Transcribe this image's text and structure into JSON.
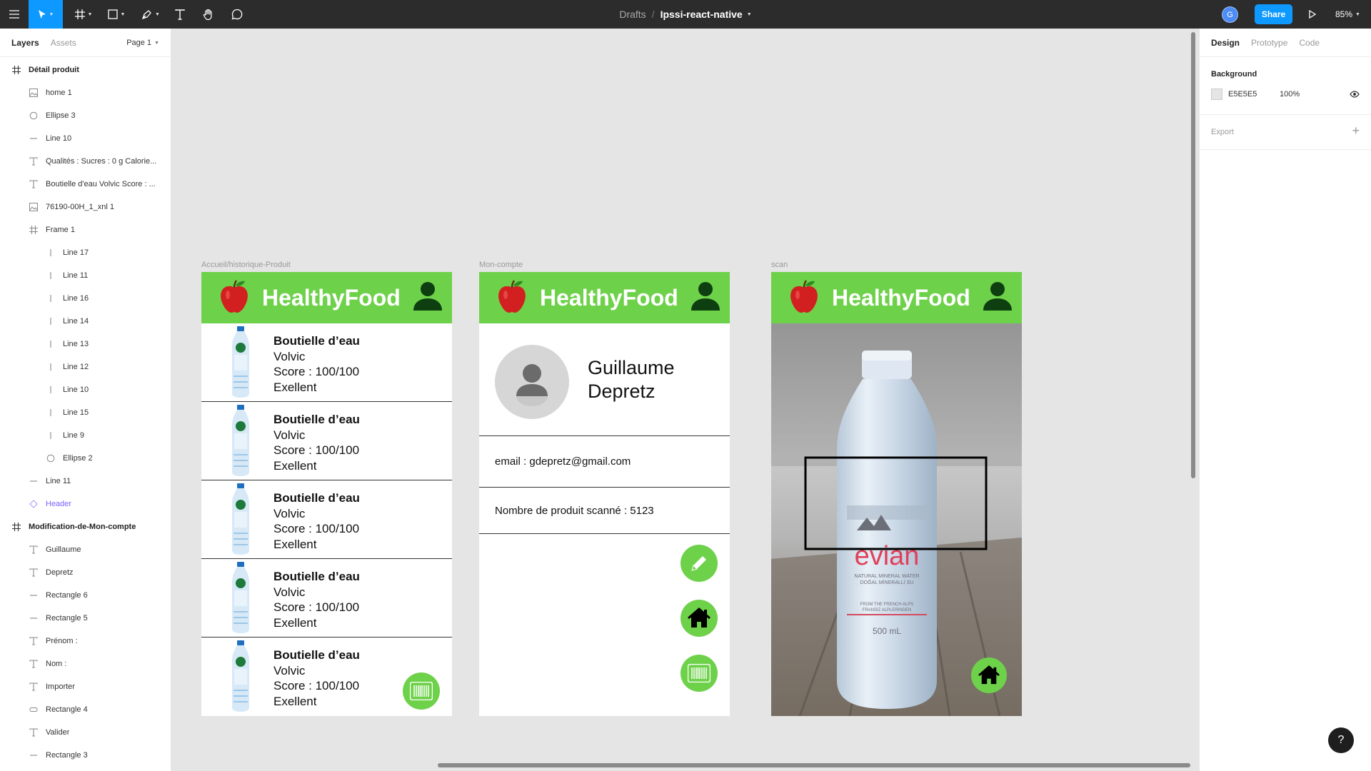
{
  "topbar": {
    "breadcrumb_drafts": "Drafts",
    "breadcrumb_sep": "/",
    "file_name": "Ipssi-react-native",
    "avatar_initial": "G",
    "share_label": "Share",
    "zoom": "85%",
    "tools": [
      "menu-icon",
      "move-icon",
      "frame-icon",
      "shape-icon",
      "pen-icon",
      "text-icon",
      "hand-icon",
      "comment-icon"
    ],
    "accent_color": "#0d99ff"
  },
  "left_panel": {
    "tab_layers": "Layers",
    "tab_assets": "Assets",
    "page_selector": "Page 1",
    "layers": [
      {
        "label": "Détail produit",
        "icon": "frame-icon",
        "depth": 0,
        "kind": "frame"
      },
      {
        "label": "home 1",
        "icon": "image-icon",
        "depth": 1,
        "kind": "layer"
      },
      {
        "label": "Ellipse 3",
        "icon": "ellipse-icon",
        "depth": 1,
        "kind": "layer"
      },
      {
        "label": "Line 10",
        "icon": "line-icon",
        "depth": 1,
        "kind": "layer"
      },
      {
        "label": "Qualités : Sucres : 0 g Calorie...",
        "icon": "text-icon",
        "depth": 1,
        "kind": "layer"
      },
      {
        "label": "Boutielle d'eau Volvic Score : ...",
        "icon": "text-icon",
        "depth": 1,
        "kind": "layer"
      },
      {
        "label": "76190-00H_1_xnl 1",
        "icon": "image-icon",
        "depth": 1,
        "kind": "layer"
      },
      {
        "label": "Frame 1",
        "icon": "frame-icon",
        "depth": 1,
        "kind": "layer"
      },
      {
        "label": "Line 17",
        "icon": "vline-icon",
        "depth": 2,
        "kind": "layer"
      },
      {
        "label": "Line 11",
        "icon": "vline-icon",
        "depth": 2,
        "kind": "layer"
      },
      {
        "label": "Line 16",
        "icon": "vline-icon",
        "depth": 2,
        "kind": "layer"
      },
      {
        "label": "Line 14",
        "icon": "vline-icon",
        "depth": 2,
        "kind": "layer"
      },
      {
        "label": "Line 13",
        "icon": "vline-icon",
        "depth": 2,
        "kind": "layer"
      },
      {
        "label": "Line 12",
        "icon": "vline-icon",
        "depth": 2,
        "kind": "layer"
      },
      {
        "label": "Line 10",
        "icon": "vline-icon",
        "depth": 2,
        "kind": "layer"
      },
      {
        "label": "Line 15",
        "icon": "vline-icon",
        "depth": 2,
        "kind": "layer"
      },
      {
        "label": "Line 9",
        "icon": "vline-icon",
        "depth": 2,
        "kind": "layer"
      },
      {
        "label": "Ellipse 2",
        "icon": "ellipse-icon",
        "depth": 2,
        "kind": "layer"
      },
      {
        "label": "Line 11",
        "icon": "line-icon",
        "depth": 1,
        "kind": "layer"
      },
      {
        "label": "Header",
        "icon": "component-icon",
        "depth": 1,
        "kind": "component"
      },
      {
        "label": "Modification-de-Mon-compte",
        "icon": "frame-icon",
        "depth": 0,
        "kind": "frame"
      },
      {
        "label": "Guillaume",
        "icon": "text-icon",
        "depth": 1,
        "kind": "layer"
      },
      {
        "label": "Depretz",
        "icon": "text-icon",
        "depth": 1,
        "kind": "layer"
      },
      {
        "label": "Rectangle 6",
        "icon": "line-icon",
        "depth": 1,
        "kind": "layer"
      },
      {
        "label": "Rectangle 5",
        "icon": "line-icon",
        "depth": 1,
        "kind": "layer"
      },
      {
        "label": "Prénom :",
        "icon": "text-icon",
        "depth": 1,
        "kind": "layer"
      },
      {
        "label": "Nom :",
        "icon": "text-icon",
        "depth": 1,
        "kind": "layer"
      },
      {
        "label": "Importer",
        "icon": "text-icon",
        "depth": 1,
        "kind": "layer"
      },
      {
        "label": "Rectangle 4",
        "icon": "rect-icon",
        "depth": 1,
        "kind": "layer"
      },
      {
        "label": "Valider",
        "icon": "text-icon",
        "depth": 1,
        "kind": "layer"
      },
      {
        "label": "Rectangle 3",
        "icon": "line-icon",
        "depth": 1,
        "kind": "layer"
      }
    ]
  },
  "right_panel": {
    "tab_design": "Design",
    "tab_prototype": "Prototype",
    "tab_code": "Code",
    "background_heading": "Background",
    "background_hex": "E5E5E5",
    "background_opacity": "100%",
    "export_label": "Export"
  },
  "canvas": {
    "background_color": "#e5e5e5",
    "brand_green": "#6ed14a",
    "frames": {
      "home": {
        "label": "Accueil/historique-Produit",
        "brand": "HealthyFood",
        "products": [
          {
            "title": "Boutielle d’eau",
            "brand": "Volvic",
            "score": "Score : 100/100",
            "rating": "Exellent"
          },
          {
            "title": "Boutielle d’eau",
            "brand": "Volvic",
            "score": "Score : 100/100",
            "rating": "Exellent"
          },
          {
            "title": "Boutielle d’eau",
            "brand": "Volvic",
            "score": "Score : 100/100",
            "rating": "Exellent"
          },
          {
            "title": "Boutielle d’eau",
            "brand": "Volvic",
            "score": "Score : 100/100",
            "rating": "Exellent"
          },
          {
            "title": "Boutielle d’eau",
            "brand": "Volvic",
            "score": "Score : 100/100",
            "rating": "Exellent"
          }
        ]
      },
      "account": {
        "label": "Mon-compte",
        "brand": "HealthyFood",
        "first_name": "Guillaume",
        "last_name": "Depretz",
        "email": "email : gdepretz@gmail.com",
        "scanned": "Nombre de produit scanné : 5123"
      },
      "scan": {
        "label": "scan",
        "brand": "HealthyFood",
        "bottle_brand": "evian",
        "bottle_line1": "NATURAL MINERAL WATER",
        "bottle_line2": "DOĞAL MİNERALLİ SU",
        "bottle_line3": "FROM THE FRENCH ALPS",
        "bottle_line4": "FRANSIZ ALPLERİNDEN",
        "bottle_volume": "500 mL"
      }
    }
  },
  "help_label": "?"
}
